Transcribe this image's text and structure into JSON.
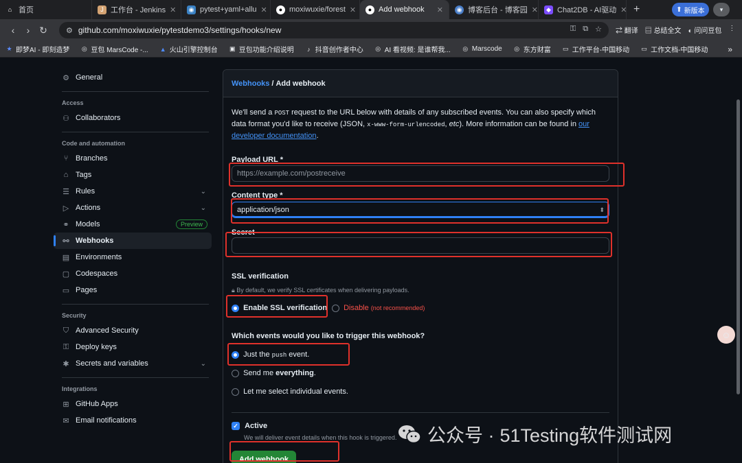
{
  "browser": {
    "tabs": [
      {
        "label": "首页",
        "icon": "home-icon"
      },
      {
        "label": "工作台 - Jenkins",
        "icon": "jenkins-icon"
      },
      {
        "label": "pytest+yaml+allu",
        "icon": "globe-icon"
      },
      {
        "label": "moxiwuxie/forest",
        "icon": "github-icon"
      },
      {
        "label": "Add webhook",
        "icon": "github-icon"
      },
      {
        "label": "博客后台 - 博客园",
        "icon": "globe-icon"
      },
      {
        "label": "Chat2DB - AI驱动",
        "icon": "chat2db-icon"
      }
    ],
    "new_version_label": "新版本",
    "url": "github.com/moxiwuxie/pytestdemo3/settings/hooks/new",
    "toolbar_actions": [
      "翻译",
      "总结全文",
      "问问豆包"
    ],
    "bookmarks": [
      "即梦AI - 即刻造梦",
      "豆包 MarsCode -...",
      "火山引擎控制台",
      "豆包功能介绍说明",
      "抖音创作者中心",
      "AI 看视频: 是谁帮我...",
      "Marscode",
      "东方财富",
      "工作平台-中国移动",
      "工作文档-中国移动"
    ]
  },
  "sidebar": {
    "general": "General",
    "sections": [
      {
        "heading": "Access",
        "items": [
          {
            "label": "Collaborators",
            "icon": "people-icon"
          }
        ]
      },
      {
        "heading": "Code and automation",
        "items": [
          {
            "label": "Branches",
            "icon": "branch-icon"
          },
          {
            "label": "Tags",
            "icon": "tag-icon"
          },
          {
            "label": "Rules",
            "icon": "rules-icon",
            "chevron": true
          },
          {
            "label": "Actions",
            "icon": "play-icon",
            "chevron": true
          },
          {
            "label": "Models",
            "icon": "models-icon",
            "badge": "Preview"
          },
          {
            "label": "Webhooks",
            "icon": "webhook-icon",
            "active": true
          },
          {
            "label": "Environments",
            "icon": "server-icon"
          },
          {
            "label": "Codespaces",
            "icon": "codespaces-icon"
          },
          {
            "label": "Pages",
            "icon": "browser-icon"
          }
        ]
      },
      {
        "heading": "Security",
        "items": [
          {
            "label": "Advanced Security",
            "icon": "shield-icon"
          },
          {
            "label": "Deploy keys",
            "icon": "key-icon"
          },
          {
            "label": "Secrets and variables",
            "icon": "asterisk-icon",
            "chevron": true
          }
        ]
      },
      {
        "heading": "Integrations",
        "items": [
          {
            "label": "GitHub Apps",
            "icon": "apps-icon"
          },
          {
            "label": "Email notifications",
            "icon": "mail-icon"
          }
        ]
      }
    ]
  },
  "form": {
    "breadcrumb_link": "Webhooks",
    "breadcrumb_sep": "/",
    "breadcrumb_current": "Add webhook",
    "intro_1": "We'll send a ",
    "intro_code_1": "POST",
    "intro_2": " request to the URL below with details of any subscribed events. You can also specify which data format you'd like to receive (JSON, ",
    "intro_code_2": "x-www-form-urlencoded",
    "intro_3": ", ",
    "intro_etc": "etc",
    "intro_4": "). More information can be found in ",
    "intro_link": "our developer documentation",
    "intro_5": ".",
    "payload_label": "Payload URL *",
    "payload_placeholder": "https://example.com/postreceive",
    "content_type_label": "Content type *",
    "content_type_value": "application/json",
    "secret_label": "Secret",
    "ssl_heading": "SSL verification",
    "ssl_hint": "By default, we verify SSL certificates when delivering payloads.",
    "ssl_enable": "Enable SSL verification",
    "ssl_disable": "Disable",
    "ssl_disable_note": "(not recommended)",
    "events_heading": "Which events would you like to trigger this webhook?",
    "event_push_1": "Just the ",
    "event_push_code": "push",
    "event_push_2": " event.",
    "event_everything_1": "Send me ",
    "event_everything_2": "everything",
    "event_everything_3": ".",
    "event_individual": "Let me select individual events.",
    "active_label": "Active",
    "active_hint": "We will deliver event details when this hook is triggered.",
    "submit_label": "Add webhook"
  },
  "watermark": {
    "sep": "公众号 · ",
    "text": "51Testing软件测试网"
  },
  "colors": {
    "accent": "#2f81f7",
    "link": "#4493f8",
    "primary_button": "#238636",
    "highlight_box": "#e0312b",
    "danger": "#f85149"
  }
}
